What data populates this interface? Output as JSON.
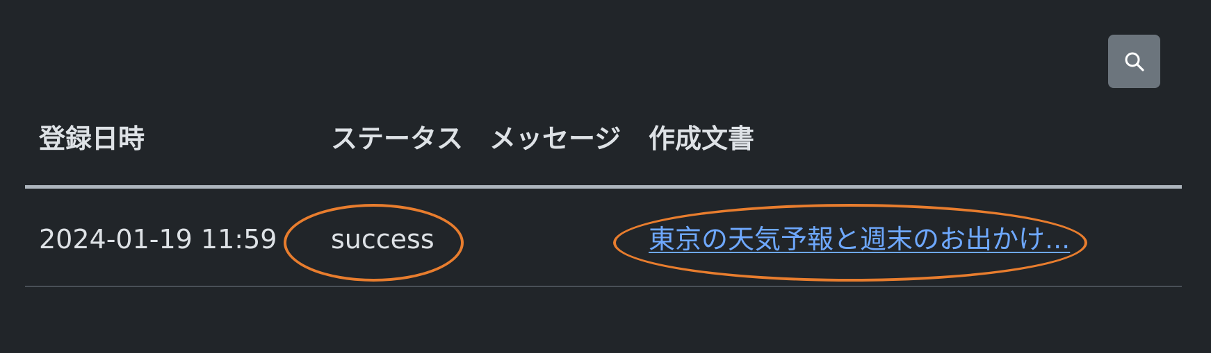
{
  "toolbar": {
    "search_icon": "search-icon"
  },
  "table": {
    "columns": [
      "登録日時",
      "ステータス",
      "メッセージ",
      "作成文書"
    ],
    "rows": [
      {
        "date": "2024-01-19 11:59",
        "status": "success",
        "message": "",
        "document": "東京の天気予報と週末のお出かけ..."
      }
    ]
  },
  "colors": {
    "background": "#212529",
    "link": "#6ea8fe",
    "highlight": "#e87d2e",
    "button": "#6c757d"
  }
}
